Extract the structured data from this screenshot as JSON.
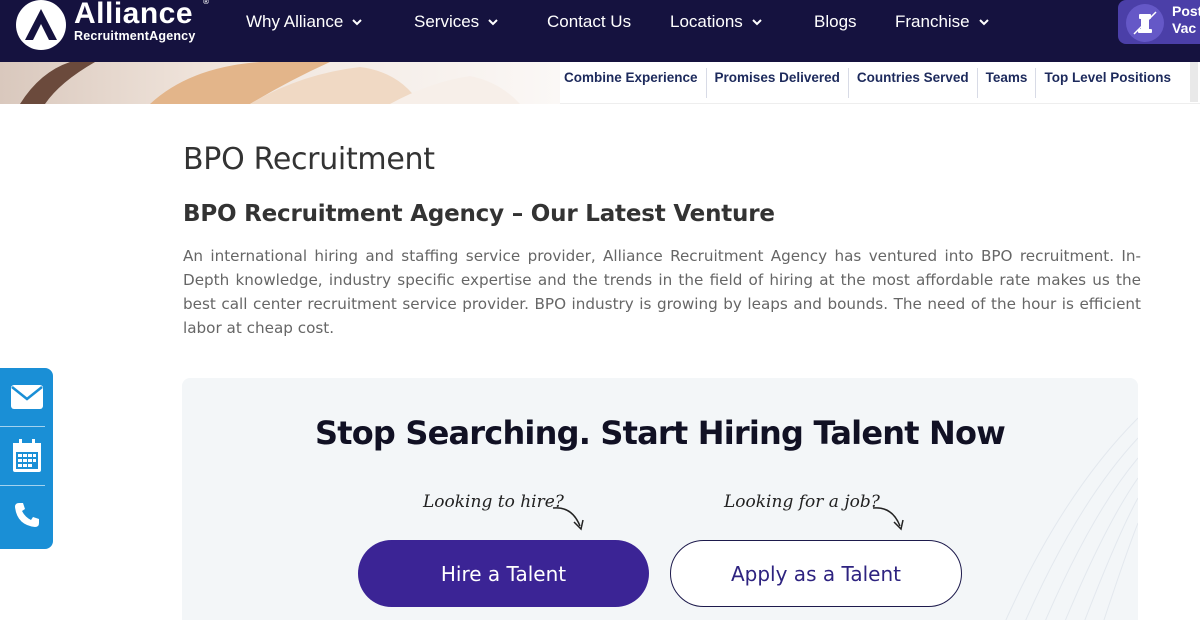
{
  "brand": {
    "name": "Alliance",
    "tagline": "RecruitmentAgency",
    "registered": "®"
  },
  "nav": {
    "items": [
      {
        "label": "Why Alliance",
        "has_dropdown": true
      },
      {
        "label": "Services",
        "has_dropdown": true
      },
      {
        "label": "Contact Us",
        "has_dropdown": false
      },
      {
        "label": "Locations",
        "has_dropdown": true
      },
      {
        "label": "Blogs",
        "has_dropdown": false
      },
      {
        "label": "Franchise",
        "has_dropdown": true
      }
    ],
    "post_line1": "Post",
    "post_line2": "Vac"
  },
  "hero": {
    "stats": [
      "Combine Experience",
      "Promises Delivered",
      "Countries Served",
      "Teams",
      "Top Level Positions"
    ]
  },
  "content": {
    "title": "BPO Recruitment",
    "subtitle": "BPO Recruitment Agency – Our Latest Venture",
    "paragraph": "An international hiring and staffing service provider, Alliance Recruitment Agency has ventured into BPO recruitment. In-Depth knowledge, industry specific expertise and the trends in the field of hiring at the most affordable rate makes us the best call center recruitment service provider. BPO industry is growing by leaps and bounds. The need of the hour is efficient labor at cheap cost."
  },
  "sidebar": {
    "icons": [
      "mail-icon",
      "calendar-icon",
      "phone-icon"
    ]
  },
  "cta": {
    "title": "Stop Searching. Start Hiring Talent Now",
    "hint_hire": "Looking to hire?",
    "hint_job": "Looking for a job?",
    "hire_button": "Hire a Talent",
    "apply_button": "Apply as a Talent"
  },
  "colors": {
    "navbar": "#15123f",
    "primary_button": "#3b2495",
    "sidebar": "#1a8fd6",
    "stat_text": "#1d2a5c",
    "cta_background": "#f3f6f8"
  }
}
